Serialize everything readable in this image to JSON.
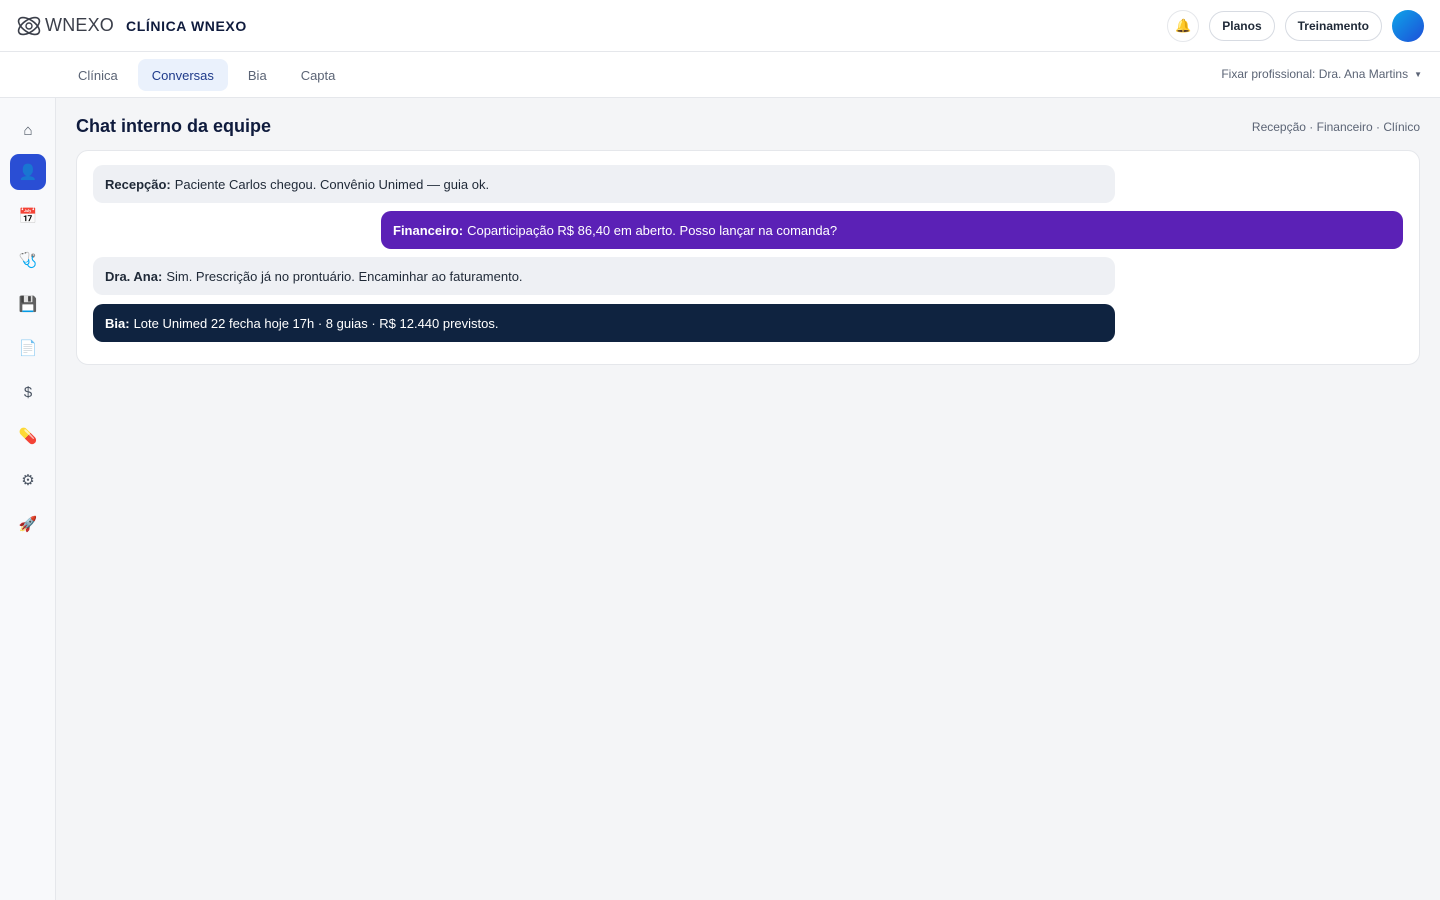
{
  "header": {
    "logo_text": "WNEXO",
    "clinic_name": "CLÍNICA WNEXO",
    "plans_label": "Planos",
    "training_label": "Treinamento"
  },
  "tabs": [
    {
      "label": "Clínica"
    },
    {
      "label": "Conversas",
      "active": true
    },
    {
      "label": "Bia"
    },
    {
      "label": "Capta"
    }
  ],
  "fixed_professional": "Fixar profissional: Dra. Ana Martins",
  "sidebar": {
    "items": [
      {
        "icon": "home-icon",
        "glyph": "⌂"
      },
      {
        "icon": "user-icon",
        "glyph": "👤",
        "active": true
      },
      {
        "icon": "calendar-icon",
        "glyph": "📅"
      },
      {
        "icon": "stethoscope-icon",
        "glyph": "🩺"
      },
      {
        "icon": "save-icon",
        "glyph": "💾"
      },
      {
        "icon": "document-icon",
        "glyph": "📄"
      },
      {
        "icon": "dollar-icon",
        "glyph": "$"
      },
      {
        "icon": "pill-icon",
        "glyph": "💊"
      },
      {
        "icon": "gear-icon",
        "glyph": "⚙"
      },
      {
        "icon": "rocket-icon",
        "glyph": "🚀"
      }
    ]
  },
  "page": {
    "title": "Chat interno da equipe",
    "channels": "Recepção · Financeiro · Clínico"
  },
  "messages": [
    {
      "author": "Recepção:",
      "text": "Paciente Carlos chegou. Convênio Unimed — guia ok.",
      "style": "light"
    },
    {
      "author": "Financeiro:",
      "text": "Coparticipação R$ 86,40 em aberto. Posso lançar na comanda?",
      "style": "purple"
    },
    {
      "author": "Dra. Ana:",
      "text": "Sim. Prescrição já no prontuário. Encaminhar ao faturamento.",
      "style": "light"
    },
    {
      "author": "Bia:",
      "text": "Lote Unimed 22 fecha hoje 17h · 8 guias · R$ 12.440 previstos.",
      "style": "dark"
    }
  ],
  "colors": {
    "accent": "#2a4ed4",
    "financeiro_bubble": "#5b21b6",
    "bia_bubble": "#0f2340"
  }
}
